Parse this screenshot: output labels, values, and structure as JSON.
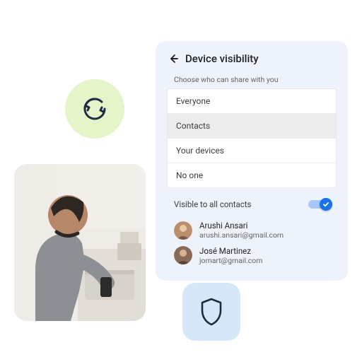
{
  "panel": {
    "title": "Device visibility",
    "choose_label": "Choose who can share with you",
    "options": [
      "Everyone",
      "Contacts",
      "Your devices",
      "No one"
    ],
    "selected_index": 1,
    "toggle_label": "Visible to all contacts",
    "toggle_on": true,
    "contacts": [
      {
        "name": "Arushi Ansari",
        "email": "arushi.ansari@gmail.com",
        "avatar_bg": "#b98f6c"
      },
      {
        "name": "José Martinez",
        "email": "jomart@gmail.com",
        "avatar_bg": "#8a6a56"
      }
    ]
  },
  "icons": {
    "sync": "sync-icon",
    "shield": "shield-icon",
    "back": "arrow-left-icon",
    "check": "check-icon"
  },
  "colors": {
    "panel_bg": "#eef3fb",
    "sync_badge_bg": "#e6f4c9",
    "shield_badge_bg": "#d6e8f8",
    "accent": "#1a73e8",
    "icon_stroke": "#1f2a44"
  }
}
